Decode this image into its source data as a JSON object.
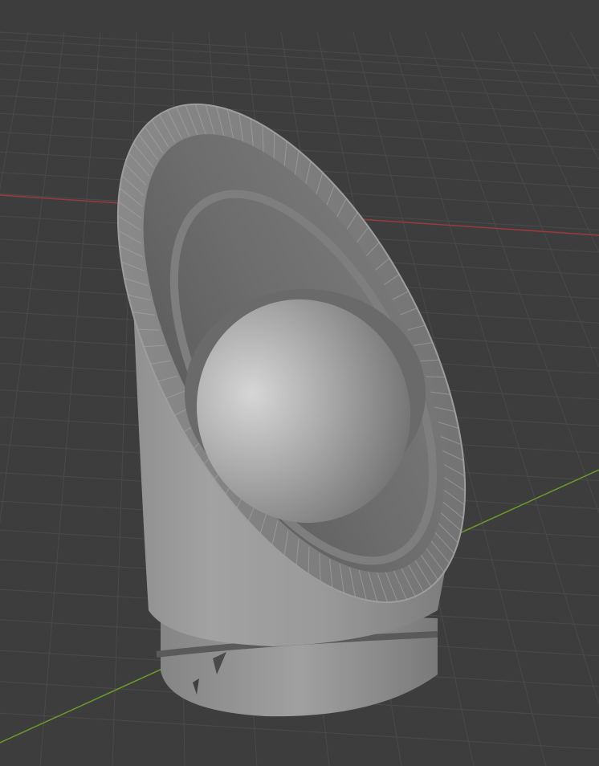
{
  "viewport": {
    "background_color": "#3d3d3d",
    "grid_color": "#4a4a4a",
    "x_axis_color": "#9a3a3f",
    "y_axis_color": "#6a9a2a"
  },
  "model": {
    "icon": "3d-object",
    "base_color": "#9c9c9c",
    "shadow_color": "#5a5a5a",
    "highlight_color": "#c8c8c8"
  }
}
